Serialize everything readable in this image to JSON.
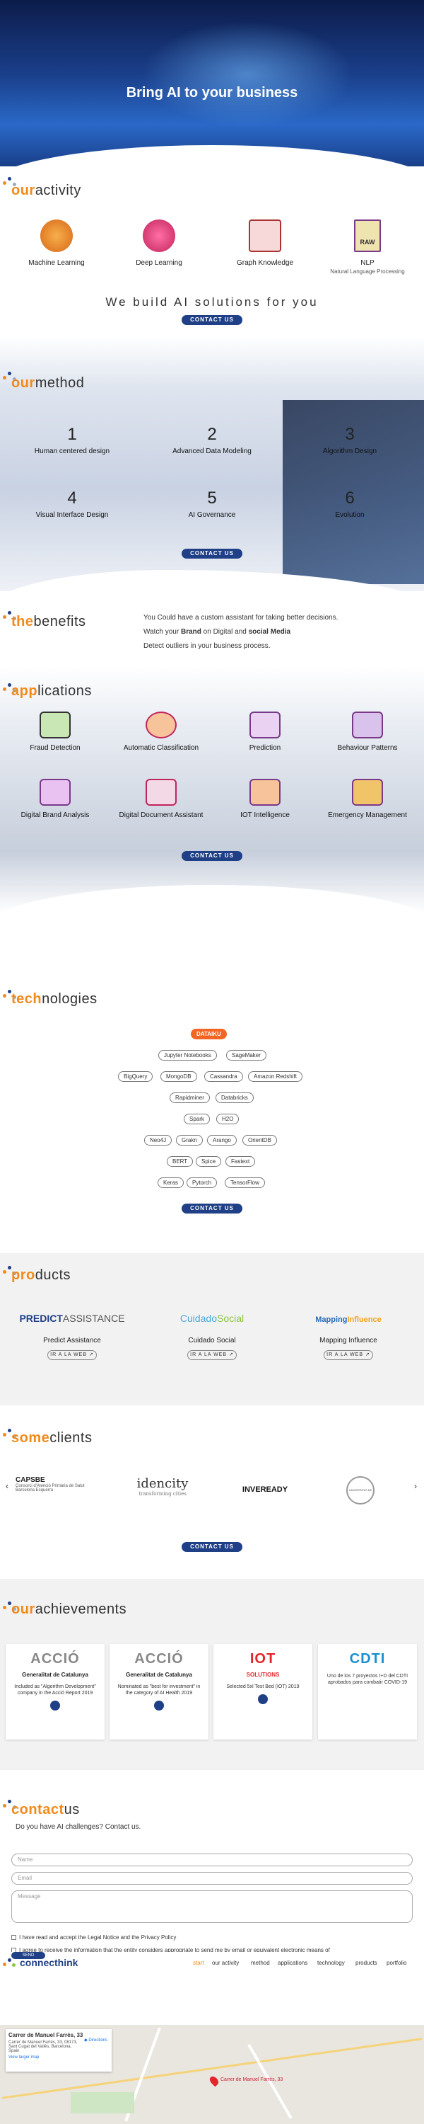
{
  "hero": {
    "title": "Bring AI to your business"
  },
  "activity": {
    "title_accent": "our",
    "title_rest": "activity",
    "items": [
      {
        "label": "Machine Learning",
        "sub": ""
      },
      {
        "label": "Deep Learning",
        "sub": ""
      },
      {
        "label": "Graph Knowledge",
        "sub": ""
      },
      {
        "label": "NLP",
        "sub": "Natural Language Processing",
        "badge": "RAW"
      }
    ],
    "tagline": "We build AI solutions for you",
    "contact_label": "CONTACT US"
  },
  "method": {
    "title_accent": "our",
    "title_rest": "method",
    "steps": [
      {
        "num": "1",
        "label": "Human centered design"
      },
      {
        "num": "2",
        "label": "Advanced Data Modeling"
      },
      {
        "num": "3",
        "label": "Algorithm Design"
      },
      {
        "num": "4",
        "label": "Visual Interface Design"
      },
      {
        "num": "5",
        "label": "AI Governance"
      },
      {
        "num": "6",
        "label": "Evolution"
      }
    ],
    "contact_label": "CONTACT US"
  },
  "benefits": {
    "title_accent": "the",
    "title_rest": "benefits",
    "line1": "You Could have a custom assistant for taking better decisions.",
    "line2_pre": "Watch your ",
    "line2_b1": "Brand",
    "line2_mid": " on Digital and ",
    "line2_b2": "social Media",
    "line3": "Detect outliers in your business process."
  },
  "applications": {
    "title_accent": "app",
    "title_rest": "lications",
    "items": [
      {
        "label": "Fraud Detection"
      },
      {
        "label": "Automatic Classification"
      },
      {
        "label": "Prediction"
      },
      {
        "label": "Behaviour Patterns"
      },
      {
        "label": "Digital Brand Analysis"
      },
      {
        "label": "Digital Document Assistant"
      },
      {
        "label": "IOT Intelligence"
      },
      {
        "label": "Emergency Management"
      }
    ],
    "contact_label": "CONTACT US"
  },
  "technologies": {
    "title_accent": "tech",
    "title_rest": "nologies",
    "highlight": "DATAIKU",
    "rows": [
      [
        "Jupyter Notebooks",
        "SageMaker"
      ],
      [
        "BigQuery",
        "MongoDB",
        "Cassandra",
        "Amazon Redshift"
      ],
      [
        "Rapidminer",
        "Databricks"
      ],
      [
        "Spark",
        "H2O"
      ],
      [
        "Neo4J",
        "Grakn",
        "Arango",
        "OrientDB"
      ],
      [
        "BERT",
        "Spice",
        "Fastext"
      ],
      [
        "Keras",
        "Pytorch",
        "TensorFlow"
      ]
    ],
    "contact_label": "CONTACT US"
  },
  "products": {
    "title_accent": "pro",
    "title_rest": "ducts",
    "items": [
      {
        "logo_a": "PREDICT",
        "logo_b": "ASSISTANCE",
        "name": "Predict Assistance",
        "web": "IR A LA WEB"
      },
      {
        "logo_a": "Cuidado",
        "logo_b": "Social",
        "name": "Cuidado Social",
        "web": "IR A LA WEB"
      },
      {
        "logo_a": "Mapping",
        "logo_b": "Influence",
        "name": "Mapping Influence",
        "web": "IR A LA WEB"
      }
    ]
  },
  "clients": {
    "title_accent": "some",
    "title_rest": "clients",
    "items": [
      "CAPSBE",
      "idencity",
      "INVEREADY",
      "UNIVERSITAT DE BARCELONA"
    ],
    "capsbe_sub": "Consorci d'Atenció Primària de Salut Barcelona Esquerra",
    "idencity_sub": "transforming cities",
    "contact_label": "CONTACT US"
  },
  "achievements": {
    "title_accent": "our",
    "title_rest": "achievements",
    "cards": [
      {
        "big": "ACCIÓ",
        "gen": "Generalitat de Catalunya",
        "desc": "Included as \"Algorithm Development\" company in the Acció Report 2019"
      },
      {
        "big": "ACCIÓ",
        "gen": "Generalitat de Catalunya",
        "desc": "Nominated as \"best for investment\" in the category of AI Health 2019"
      },
      {
        "big": "IOT",
        "gen": "SOLUTIONS",
        "desc": "Selected 5xl Test Bed (IOT) 2019"
      },
      {
        "big": "CDTI",
        "gen": "",
        "desc": "Uno de los 7 proyectos I+D del CDTI aprobados para combatir COVID-19"
      }
    ]
  },
  "contact": {
    "title_accent": "contact",
    "title_rest": "us",
    "question": "Do you have AI challenges? Contact us.",
    "name_ph": "Name",
    "email_ph": "Email",
    "message_ph": "Message",
    "check1": "I have read and accept the Legal Notice and the Privacy Policy",
    "check2": "I agree to receive the information that the entity considers appropriate to send me by email or equivalent electronic means of",
    "send": "SEND"
  },
  "nav": {
    "brand": "connecthink",
    "items": [
      "start",
      "our activity",
      "method",
      "applications",
      "technology",
      "products",
      "portfolio"
    ]
  },
  "map": {
    "place": "Carrer de Manuel Farrés, 33",
    "address": "Carrer de Manuel Farrés, 33, 08173, Sant Cugat del Vallès, Barcelona, Spain",
    "larger": "View larger map",
    "directions": "Directions",
    "pin_label": "Carrer de Manuel Farrés, 33"
  },
  "colors": {
    "accent": "#f28a1b",
    "primary": "#1f3f86",
    "hot": "#f26522"
  }
}
